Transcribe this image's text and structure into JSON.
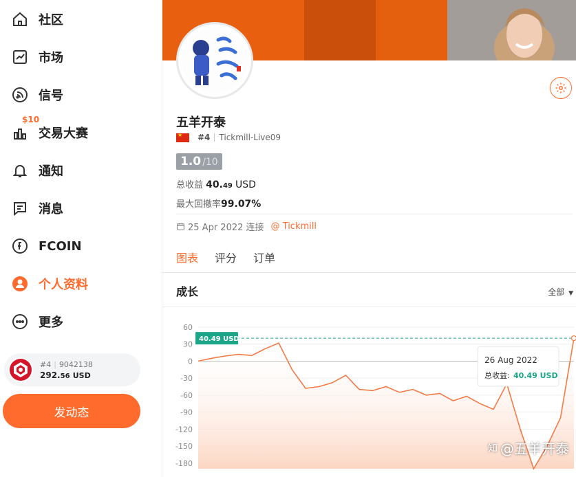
{
  "sidebar": {
    "items": [
      {
        "label": "社区",
        "icon": "home-icon"
      },
      {
        "label": "市场",
        "icon": "chart-line-icon"
      },
      {
        "label": "信号",
        "icon": "signal-icon"
      },
      {
        "label": "交易大赛",
        "icon": "bar-chart-icon",
        "badge": "$10"
      },
      {
        "label": "通知",
        "icon": "bell-icon"
      },
      {
        "label": "消息",
        "icon": "message-icon"
      },
      {
        "label": "FCOIN",
        "icon": "fcoin-icon"
      },
      {
        "label": "个人资料",
        "icon": "user-icon",
        "active": true
      },
      {
        "label": "更多",
        "icon": "more-icon"
      }
    ],
    "account": {
      "rank": "#4",
      "id": "9042138",
      "balance_int": "292.",
      "balance_dec": "56",
      "currency": "USD"
    },
    "post_button": "发动态"
  },
  "profile": {
    "name": "五羊开泰",
    "rank": "#4",
    "account": "Tickmill-Live09",
    "score": "1.0",
    "score_max": "/10",
    "total_profit_label": "总收益",
    "total_profit_int": "40.",
    "total_profit_dec": "49",
    "total_profit_currency": "USD",
    "max_drawdown_label": "最大回撤率",
    "max_drawdown": "99.07%",
    "connected_date": "25 Apr 2022 连接",
    "broker": "@ Tickmill"
  },
  "tabs": [
    {
      "label": "图表",
      "active": true
    },
    {
      "label": "评分"
    },
    {
      "label": "订单"
    }
  ],
  "section": {
    "title": "成长",
    "range": "全部"
  },
  "chart_data": {
    "type": "area",
    "y_ticks": [
      60,
      30,
      0,
      -30,
      -60,
      -90,
      -120,
      -150,
      -180
    ],
    "ylim": [
      -190,
      60
    ],
    "series": [
      {
        "values": [
          0,
          5,
          9,
          12,
          10,
          22,
          32,
          -15,
          -48,
          -45,
          -38,
          -25,
          -50,
          -52,
          -45,
          -55,
          -50,
          -60,
          -57,
          -70,
          -62,
          -75,
          -85,
          -40,
          -120,
          -190,
          -150,
          -100,
          40.49
        ]
      }
    ],
    "current_label": "40.49 USD",
    "tooltip": {
      "date": "26 Aug 2022",
      "label": "总收益:",
      "value": "40.49 USD"
    },
    "colors": {
      "line": "#f37a45",
      "fill_top": "#ffffff",
      "fill_bottom": "#fcd6c3",
      "tag": "#1aa687"
    }
  },
  "watermark": "@五羊开泰"
}
